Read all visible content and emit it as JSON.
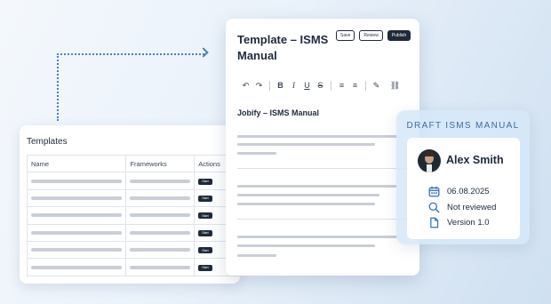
{
  "templates": {
    "title": "Templates",
    "columns": [
      "Name",
      "Frameworks",
      "Actions"
    ],
    "row_count": 6,
    "action_label": "Start"
  },
  "editor": {
    "title": "Template – ISMS Manual",
    "buttons": {
      "save": "Save",
      "review": "Review",
      "publish": "Publish"
    },
    "toolbar": {
      "undo_icon": "↶",
      "redo_icon": "↷",
      "bold": "B",
      "italic": "I",
      "underline": "U",
      "strike": "S",
      "list_icon": "≡",
      "align_icon": "≡",
      "pen_icon": "✎",
      "link_icon": "⛓"
    },
    "document_title": "Jobify – ISMS Manual"
  },
  "draft": {
    "label": "DRAFT ISMS MANUAL",
    "user_name": "Alex Smith",
    "date": "06.08.2025",
    "review_status": "Not reviewed",
    "version": "Version 1.0"
  },
  "colors": {
    "accent_blue": "#3f6d99",
    "icon_blue": "#2f6fc7",
    "dark": "#1f2a3a",
    "skeleton": "#c9ced6"
  }
}
